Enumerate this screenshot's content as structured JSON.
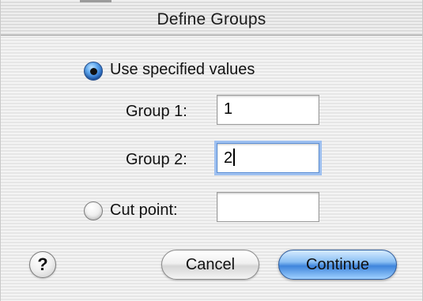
{
  "window": {
    "title": "Define Groups"
  },
  "options": {
    "use_specified_values": {
      "label": "Use specified values",
      "selected": true
    },
    "cut_point": {
      "label": "Cut point:",
      "selected": false,
      "value": ""
    }
  },
  "groups": [
    {
      "label": "Group 1:",
      "value": "1"
    },
    {
      "label": "Group 2:",
      "value": "2"
    }
  ],
  "buttons": {
    "help": "?",
    "cancel": "Cancel",
    "continue": "Continue"
  },
  "colors": {
    "accent": "#3f85dc",
    "focus_ring": "#9ec0f0"
  }
}
